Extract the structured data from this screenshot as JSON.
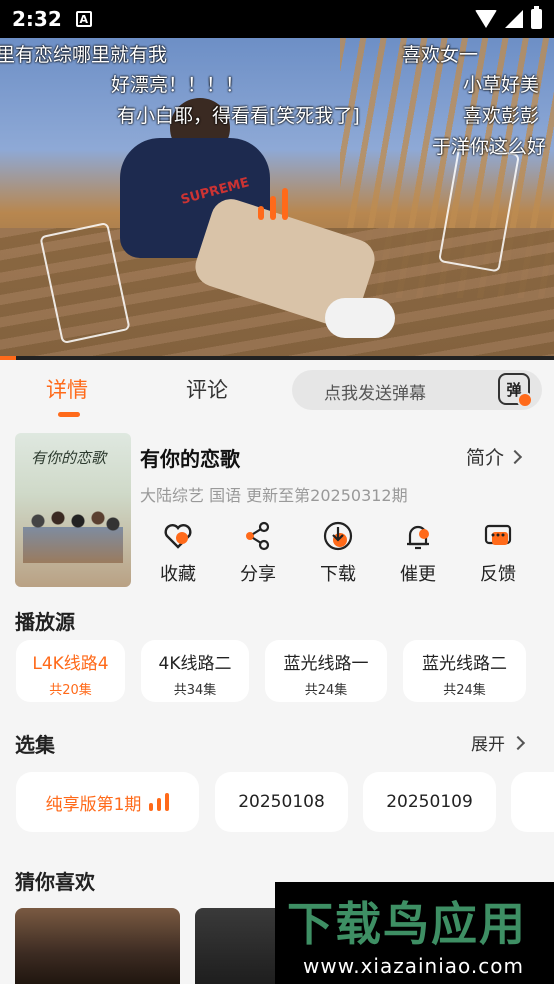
{
  "status_bar": {
    "time": "2:32",
    "badge": "A"
  },
  "danmaku": [
    "里有恋综哪里就有我",
    "喜欢女一",
    "好漂亮！！！！",
    "小草好美",
    "有小白耶，得看看[笑死我了]",
    "喜欢彭彭",
    "于洋你这么好"
  ],
  "tabs": {
    "detail": "详情",
    "comments": "评论"
  },
  "danmaku_input": {
    "placeholder": "点我发送弹幕",
    "button": "弹"
  },
  "show": {
    "poster_title": "有你的恋歌",
    "title": "有你的恋歌",
    "intro_link": "简介",
    "meta": "大陆综艺 国语 更新至第20250312期"
  },
  "actions": [
    "收藏",
    "分享",
    "下载",
    "催更",
    "反馈"
  ],
  "play_source": {
    "title": "播放源",
    "items": [
      {
        "name": "L4K线路4",
        "count": "共20集",
        "active": true
      },
      {
        "name": "4K线路二",
        "count": "共34集",
        "active": false
      },
      {
        "name": "蓝光线路一",
        "count": "共24集",
        "active": false
      },
      {
        "name": "蓝光线路二",
        "count": "共24集",
        "active": false
      }
    ]
  },
  "episodes": {
    "title": "选集",
    "expand": "展开",
    "items": [
      "纯享版第1期",
      "20250108",
      "20250109"
    ]
  },
  "recommend": {
    "title": "猜你喜欢"
  },
  "watermark": {
    "big": "下载鸟应用",
    "small": "www.xiazainiao.com"
  },
  "colors": {
    "accent": "#ff6a1a",
    "background": "#f5f5f5",
    "card": "#ffffff"
  }
}
